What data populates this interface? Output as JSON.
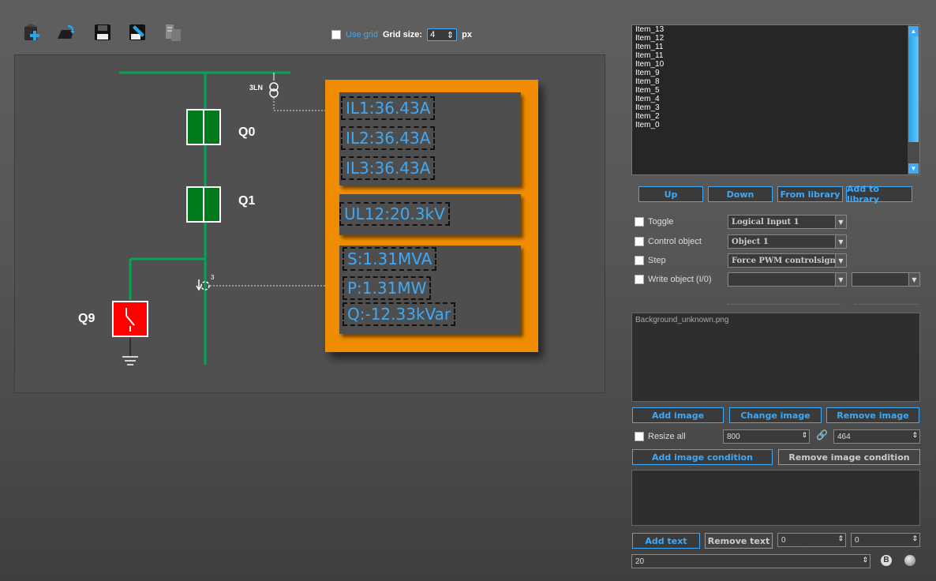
{
  "toolbar": {
    "icons": [
      "new-item-icon",
      "open-icon",
      "save-icon",
      "edit-icon",
      "copy-icon"
    ],
    "use_grid_label": "Use grid",
    "grid_size_label": "Grid size:",
    "grid_size_value": "4",
    "grid_unit": "px"
  },
  "diagram": {
    "transformer_label": "3LN",
    "bay_labels": [
      "Q0",
      "Q1",
      "Q9"
    ],
    "sensor_label": "3",
    "measurements": {
      "il1": "IL1:36.43A",
      "il2": "IL2:36.43A",
      "il3": "IL3:36.43A",
      "ul12": "UL12:20.3kV",
      "s": "S:1.31MVA",
      "p": "P:1.31MW",
      "q": "Q:-12.33kVar"
    },
    "colors": {
      "busbar": "#00a651",
      "breaker_closed": "#007a1c",
      "breaker_open": "#ff0000",
      "frame": "#f08c00",
      "text": "#3fa9f5"
    }
  },
  "item_list": {
    "items": [
      "Item_13",
      "Item_12",
      "Item_11",
      "Item_11",
      "Item_10",
      "Item_9",
      "Item_8",
      "Item_5",
      "Item_4",
      "Item_3",
      "Item_2",
      "Item_0"
    ]
  },
  "list_buttons": {
    "up": "Up",
    "down": "Down",
    "from_library": "From library",
    "add_to_library": "Add to library"
  },
  "options": {
    "toggle": {
      "label": "Toggle",
      "value": "Logical Input 1"
    },
    "control_object": {
      "label": "Control object",
      "value": "Object 1"
    },
    "step": {
      "label": "Step",
      "value": "Force PWM controlsignal"
    },
    "write_object": {
      "label": "Write object (I/0)",
      "value": "",
      "value2": ""
    }
  },
  "images": {
    "current": "Background_unknown.png",
    "add": "Add image",
    "change": "Change image",
    "remove": "Remove image",
    "resize_all": "Resize all",
    "width": "800",
    "height": "464",
    "add_condition": "Add image condition",
    "remove_condition": "Remove image condition"
  },
  "text": {
    "add": "Add text",
    "remove": "Remove text",
    "x": "0",
    "y": "0",
    "size": "20"
  }
}
